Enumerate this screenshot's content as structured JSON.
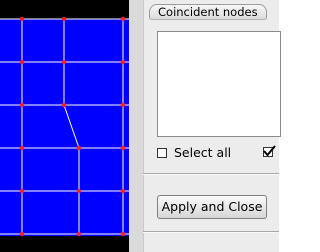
{
  "colors": {
    "mesh_background": "#0000ff",
    "mesh_lines": "#ffffff",
    "mesh_nodes": "#ff2020"
  },
  "panel": {
    "group_title": "Coincident nodes",
    "select_all_label": "Select all",
    "select_all_checked": false,
    "second_checkbox_checked": true,
    "apply_button_label": "Apply and Close"
  }
}
